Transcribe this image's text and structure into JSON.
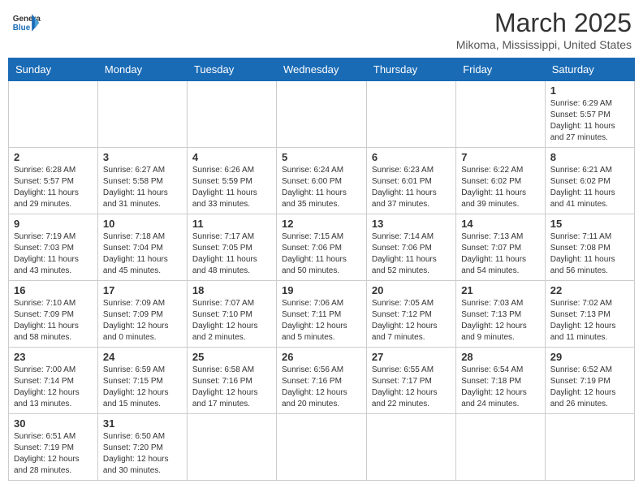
{
  "header": {
    "logo_general": "General",
    "logo_blue": "Blue",
    "month": "March 2025",
    "location": "Mikoma, Mississippi, United States"
  },
  "weekdays": [
    "Sunday",
    "Monday",
    "Tuesday",
    "Wednesday",
    "Thursday",
    "Friday",
    "Saturday"
  ],
  "weeks": [
    [
      {
        "day": "",
        "info": ""
      },
      {
        "day": "",
        "info": ""
      },
      {
        "day": "",
        "info": ""
      },
      {
        "day": "",
        "info": ""
      },
      {
        "day": "",
        "info": ""
      },
      {
        "day": "",
        "info": ""
      },
      {
        "day": "1",
        "info": "Sunrise: 6:29 AM\nSunset: 5:57 PM\nDaylight: 11 hours\nand 27 minutes."
      }
    ],
    [
      {
        "day": "2",
        "info": "Sunrise: 6:28 AM\nSunset: 5:57 PM\nDaylight: 11 hours\nand 29 minutes."
      },
      {
        "day": "3",
        "info": "Sunrise: 6:27 AM\nSunset: 5:58 PM\nDaylight: 11 hours\nand 31 minutes."
      },
      {
        "day": "4",
        "info": "Sunrise: 6:26 AM\nSunset: 5:59 PM\nDaylight: 11 hours\nand 33 minutes."
      },
      {
        "day": "5",
        "info": "Sunrise: 6:24 AM\nSunset: 6:00 PM\nDaylight: 11 hours\nand 35 minutes."
      },
      {
        "day": "6",
        "info": "Sunrise: 6:23 AM\nSunset: 6:01 PM\nDaylight: 11 hours\nand 37 minutes."
      },
      {
        "day": "7",
        "info": "Sunrise: 6:22 AM\nSunset: 6:02 PM\nDaylight: 11 hours\nand 39 minutes."
      },
      {
        "day": "8",
        "info": "Sunrise: 6:21 AM\nSunset: 6:02 PM\nDaylight: 11 hours\nand 41 minutes."
      }
    ],
    [
      {
        "day": "9",
        "info": "Sunrise: 7:19 AM\nSunset: 7:03 PM\nDaylight: 11 hours\nand 43 minutes."
      },
      {
        "day": "10",
        "info": "Sunrise: 7:18 AM\nSunset: 7:04 PM\nDaylight: 11 hours\nand 45 minutes."
      },
      {
        "day": "11",
        "info": "Sunrise: 7:17 AM\nSunset: 7:05 PM\nDaylight: 11 hours\nand 48 minutes."
      },
      {
        "day": "12",
        "info": "Sunrise: 7:15 AM\nSunset: 7:06 PM\nDaylight: 11 hours\nand 50 minutes."
      },
      {
        "day": "13",
        "info": "Sunrise: 7:14 AM\nSunset: 7:06 PM\nDaylight: 11 hours\nand 52 minutes."
      },
      {
        "day": "14",
        "info": "Sunrise: 7:13 AM\nSunset: 7:07 PM\nDaylight: 11 hours\nand 54 minutes."
      },
      {
        "day": "15",
        "info": "Sunrise: 7:11 AM\nSunset: 7:08 PM\nDaylight: 11 hours\nand 56 minutes."
      }
    ],
    [
      {
        "day": "16",
        "info": "Sunrise: 7:10 AM\nSunset: 7:09 PM\nDaylight: 11 hours\nand 58 minutes."
      },
      {
        "day": "17",
        "info": "Sunrise: 7:09 AM\nSunset: 7:09 PM\nDaylight: 12 hours\nand 0 minutes."
      },
      {
        "day": "18",
        "info": "Sunrise: 7:07 AM\nSunset: 7:10 PM\nDaylight: 12 hours\nand 2 minutes."
      },
      {
        "day": "19",
        "info": "Sunrise: 7:06 AM\nSunset: 7:11 PM\nDaylight: 12 hours\nand 5 minutes."
      },
      {
        "day": "20",
        "info": "Sunrise: 7:05 AM\nSunset: 7:12 PM\nDaylight: 12 hours\nand 7 minutes."
      },
      {
        "day": "21",
        "info": "Sunrise: 7:03 AM\nSunset: 7:13 PM\nDaylight: 12 hours\nand 9 minutes."
      },
      {
        "day": "22",
        "info": "Sunrise: 7:02 AM\nSunset: 7:13 PM\nDaylight: 12 hours\nand 11 minutes."
      }
    ],
    [
      {
        "day": "23",
        "info": "Sunrise: 7:00 AM\nSunset: 7:14 PM\nDaylight: 12 hours\nand 13 minutes."
      },
      {
        "day": "24",
        "info": "Sunrise: 6:59 AM\nSunset: 7:15 PM\nDaylight: 12 hours\nand 15 minutes."
      },
      {
        "day": "25",
        "info": "Sunrise: 6:58 AM\nSunset: 7:16 PM\nDaylight: 12 hours\nand 17 minutes."
      },
      {
        "day": "26",
        "info": "Sunrise: 6:56 AM\nSunset: 7:16 PM\nDaylight: 12 hours\nand 20 minutes."
      },
      {
        "day": "27",
        "info": "Sunrise: 6:55 AM\nSunset: 7:17 PM\nDaylight: 12 hours\nand 22 minutes."
      },
      {
        "day": "28",
        "info": "Sunrise: 6:54 AM\nSunset: 7:18 PM\nDaylight: 12 hours\nand 24 minutes."
      },
      {
        "day": "29",
        "info": "Sunrise: 6:52 AM\nSunset: 7:19 PM\nDaylight: 12 hours\nand 26 minutes."
      }
    ],
    [
      {
        "day": "30",
        "info": "Sunrise: 6:51 AM\nSunset: 7:19 PM\nDaylight: 12 hours\nand 28 minutes."
      },
      {
        "day": "31",
        "info": "Sunrise: 6:50 AM\nSunset: 7:20 PM\nDaylight: 12 hours\nand 30 minutes."
      },
      {
        "day": "",
        "info": ""
      },
      {
        "day": "",
        "info": ""
      },
      {
        "day": "",
        "info": ""
      },
      {
        "day": "",
        "info": ""
      },
      {
        "day": "",
        "info": ""
      }
    ]
  ]
}
